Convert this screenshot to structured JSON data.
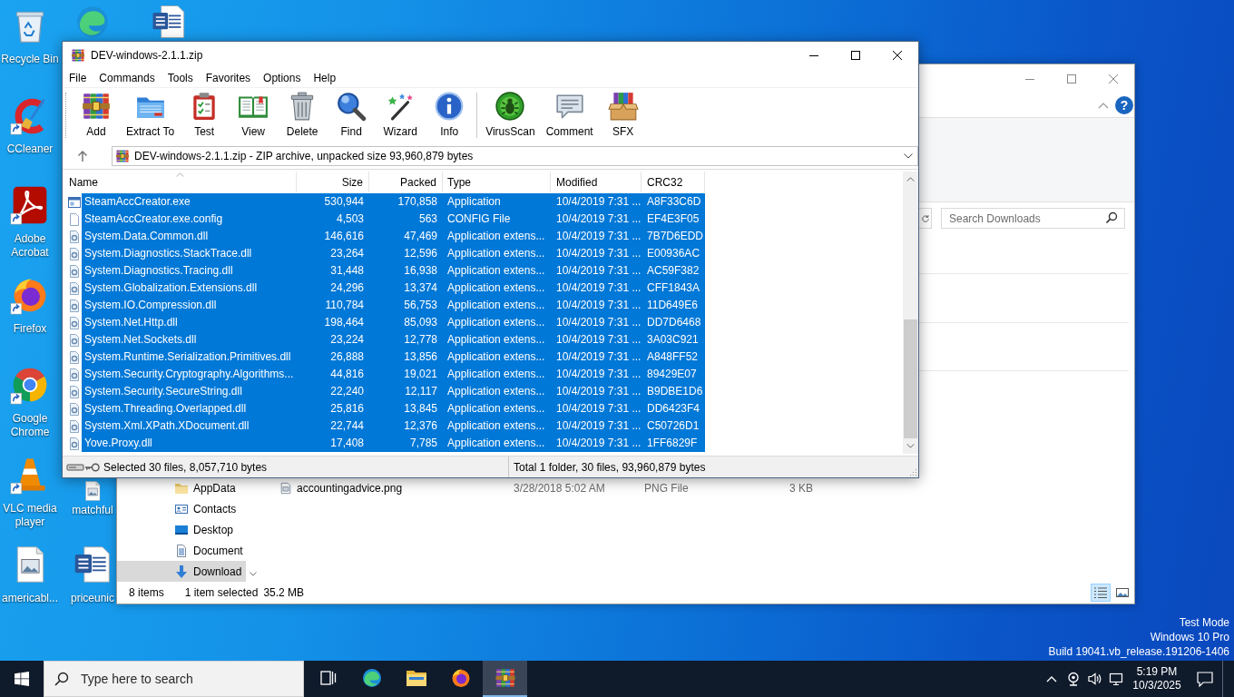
{
  "desktop": {
    "icons": [
      {
        "kind": "recyclebin",
        "label": "Recycle Bin",
        "shortcut": false
      },
      {
        "kind": "broom",
        "label": "CCleaner",
        "shortcut": true
      },
      {
        "kind": "acrobat",
        "label": "Adobe Acrobat",
        "shortcut": true
      },
      {
        "kind": "firefox",
        "label": "Firefox",
        "shortcut": true
      },
      {
        "kind": "chrome",
        "label": "Google Chrome",
        "shortcut": true
      },
      {
        "kind": "vlc",
        "label": "VLC media player",
        "shortcut": true
      },
      {
        "kind": "image",
        "label": "americabl...",
        "shortcut": false
      },
      {
        "kind": "edge",
        "shortcut": false
      },
      {
        "kind": "image",
        "label": "matchful",
        "shortcut": false
      },
      {
        "kind": "word",
        "label": "priceunic",
        "shortcut": false
      },
      {
        "kind": "word",
        "shortcut": false
      }
    ],
    "os_notice": [
      "Test Mode",
      "Windows 10 Pro",
      "Build 19041.vb_release.191206-1406"
    ]
  },
  "explorer_window": {
    "help": "?",
    "search": {
      "placeholder": "Search Downloads"
    },
    "nav_items": [
      {
        "kind": "folder",
        "label": "AppData",
        "selected": false
      },
      {
        "kind": "contacts",
        "label": "Contacts",
        "selected": false
      },
      {
        "kind": "desktop",
        "label": "Desktop",
        "selected": false
      },
      {
        "kind": "documents",
        "label": "Document",
        "selected": false
      },
      {
        "kind": "downloads",
        "label": "Download",
        "selected": true
      }
    ],
    "files": [
      {
        "name": "accountingadvice.png",
        "modified": "3/28/2018 5:02 AM",
        "type": "PNG File",
        "size": "3 KB",
        "selected": false
      }
    ],
    "status_bar": {
      "items": "8 items",
      "selection": "1 item selected",
      "size": "35.2 MB"
    },
    "views": [
      {
        "kind": "details",
        "selected": true
      },
      {
        "kind": "thumbnails",
        "selected": false
      }
    ]
  },
  "winrar_window": {
    "title": "DEV-windows-2.1.1.zip",
    "menu": [
      "File",
      "Commands",
      "Tools",
      "Favorites",
      "Options",
      "Help"
    ],
    "toolbar_groups": [
      [
        {
          "kind": "add",
          "label": "Add"
        },
        {
          "kind": "extract",
          "label": "Extract To"
        },
        {
          "kind": "test",
          "label": "Test"
        },
        {
          "kind": "view",
          "label": "View"
        },
        {
          "kind": "delete",
          "label": "Delete"
        },
        {
          "kind": "find",
          "label": "Find"
        },
        {
          "kind": "wizard",
          "label": "Wizard"
        },
        {
          "kind": "info",
          "label": "Info"
        }
      ],
      [
        {
          "kind": "virusscan",
          "label": "VirusScan"
        },
        {
          "kind": "comment",
          "label": "Comment"
        },
        {
          "kind": "sfx",
          "label": "SFX"
        }
      ]
    ],
    "path": "DEV-windows-2.1.1.zip - ZIP archive, unpacked size 93,960,879 bytes",
    "columns": [
      {
        "label": "Name",
        "sorted": true
      },
      {
        "label": "Size",
        "sorted": false
      },
      {
        "label": "Packed",
        "sorted": false
      },
      {
        "label": "Type",
        "sorted": false
      },
      {
        "label": "Modified",
        "sorted": false
      },
      {
        "label": "CRC32",
        "sorted": false
      }
    ],
    "rows": [
      {
        "kind": "exe",
        "cells": [
          "SteamAccCreator.exe",
          "530,944",
          "170,858",
          "Application",
          "10/4/2019 7:31 ...",
          "A8F33C6D"
        ],
        "selected": true
      },
      {
        "kind": "config",
        "cells": [
          "SteamAccCreator.exe.config",
          "4,503",
          "563",
          "CONFIG File",
          "10/4/2019 7:31 ...",
          "EF4E3F05"
        ],
        "selected": true
      },
      {
        "kind": "dll",
        "cells": [
          "System.Data.Common.dll",
          "146,616",
          "47,469",
          "Application extens...",
          "10/4/2019 7:31 ...",
          "7B7D6EDD"
        ],
        "selected": true
      },
      {
        "kind": "dll",
        "cells": [
          "System.Diagnostics.StackTrace.dll",
          "23,264",
          "12,596",
          "Application extens...",
          "10/4/2019 7:31 ...",
          "E00936AC"
        ],
        "selected": true
      },
      {
        "kind": "dll",
        "cells": [
          "System.Diagnostics.Tracing.dll",
          "31,448",
          "16,938",
          "Application extens...",
          "10/4/2019 7:31 ...",
          "AC59F382"
        ],
        "selected": true
      },
      {
        "kind": "dll",
        "cells": [
          "System.Globalization.Extensions.dll",
          "24,296",
          "13,374",
          "Application extens...",
          "10/4/2019 7:31 ...",
          "CFF1843A"
        ],
        "selected": true
      },
      {
        "kind": "dll",
        "cells": [
          "System.IO.Compression.dll",
          "110,784",
          "56,753",
          "Application extens...",
          "10/4/2019 7:31 ...",
          "11D649E6"
        ],
        "selected": true
      },
      {
        "kind": "dll",
        "cells": [
          "System.Net.Http.dll",
          "198,464",
          "85,093",
          "Application extens...",
          "10/4/2019 7:31 ...",
          "DD7D6468"
        ],
        "selected": true
      },
      {
        "kind": "dll",
        "cells": [
          "System.Net.Sockets.dll",
          "23,224",
          "12,778",
          "Application extens...",
          "10/4/2019 7:31 ...",
          "3A03C921"
        ],
        "selected": true
      },
      {
        "kind": "dll",
        "cells": [
          "System.Runtime.Serialization.Primitives.dll",
          "26,888",
          "13,856",
          "Application extens...",
          "10/4/2019 7:31 ...",
          "A848FF52"
        ],
        "selected": true
      },
      {
        "kind": "dll",
        "cells": [
          "System.Security.Cryptography.Algorithms...",
          "44,816",
          "19,021",
          "Application extens...",
          "10/4/2019 7:31 ...",
          "89429E07"
        ],
        "selected": true
      },
      {
        "kind": "dll",
        "cells": [
          "System.Security.SecureString.dll",
          "22,240",
          "12,117",
          "Application extens...",
          "10/4/2019 7:31 ...",
          "B9DBE1D6"
        ],
        "selected": true
      },
      {
        "kind": "dll",
        "cells": [
          "System.Threading.Overlapped.dll",
          "25,816",
          "13,845",
          "Application extens...",
          "10/4/2019 7:31 ...",
          "DD6423F4"
        ],
        "selected": true
      },
      {
        "kind": "dll",
        "cells": [
          "System.Xml.XPath.XDocument.dll",
          "22,744",
          "12,376",
          "Application extens...",
          "10/4/2019 7:31 ...",
          "C50726D1"
        ],
        "selected": true
      },
      {
        "kind": "dll",
        "cells": [
          "Yove.Proxy.dll",
          "17,408",
          "7,785",
          "Application extens...",
          "10/4/2019 7:31 ...",
          "1FF6829F"
        ],
        "selected": true
      }
    ],
    "status_bar": {
      "selection": "Selected 30 files, 8,057,710 bytes",
      "total": "Total 1 folder, 30 files, 93,960,879 bytes"
    }
  },
  "taskbar": {
    "search": {
      "placeholder": "Type here to search"
    },
    "apps": [
      {
        "kind": "edge",
        "active": false
      },
      {
        "kind": "explorer",
        "active": false
      },
      {
        "kind": "firefox",
        "active": false
      },
      {
        "kind": "winrar",
        "active": true
      }
    ],
    "time": "5:19 PM",
    "date": "10/3/2025"
  }
}
